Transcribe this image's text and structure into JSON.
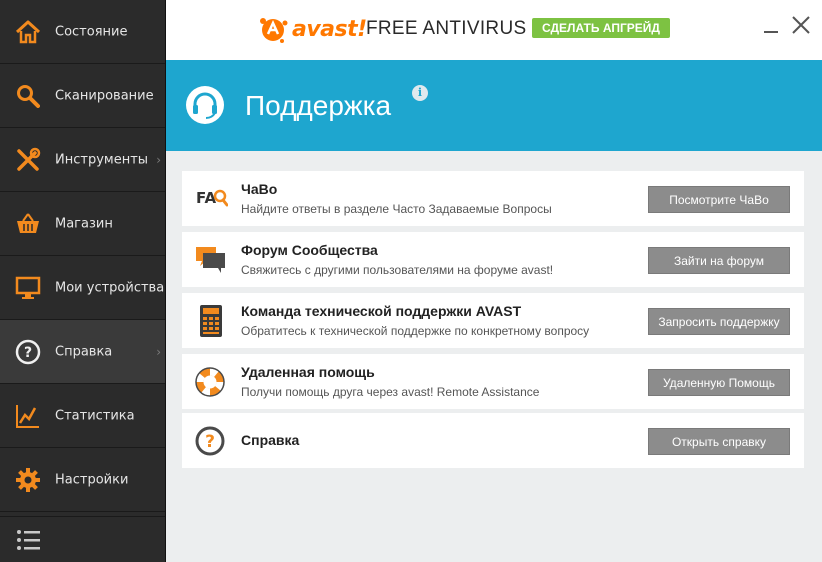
{
  "app": {
    "brand": "avast!",
    "product": "FREE ANTIVIRUS",
    "upgrade_label": "СДЕЛАТЬ АПГРЕЙД",
    "brand_color": "#ff7800",
    "accent_color": "#1ea6cf",
    "upgrade_color": "#7dc242"
  },
  "sidebar": {
    "items": [
      {
        "label": "Состояние",
        "icon": "home-icon"
      },
      {
        "label": "Сканирование",
        "icon": "magnifier-icon"
      },
      {
        "label": "Инструменты",
        "icon": "tools-icon",
        "has_submenu": true
      },
      {
        "label": "Магазин",
        "icon": "basket-icon"
      },
      {
        "label": "Мои устройства",
        "icon": "monitor-icon"
      },
      {
        "label": "Справка",
        "icon": "help-icon",
        "has_submenu": true,
        "active": true
      },
      {
        "label": "Статистика",
        "icon": "chart-icon"
      },
      {
        "label": "Настройки",
        "icon": "gear-icon"
      }
    ],
    "bottom_icon": "list-icon"
  },
  "banner": {
    "title": "Поддержка",
    "icon": "headset-icon",
    "info": "i"
  },
  "cards": [
    {
      "title": "ЧаВо",
      "desc": "Найдите ответы в разделе Часто Задаваемые Вопросы",
      "button": "Посмотрите ЧаВо",
      "icon": "faq-icon",
      "icon_text": "FA"
    },
    {
      "title": "Форум Сообщества",
      "desc": "Свяжитесь с другими пользователями на форуме avast!",
      "button": "Зайти на форум",
      "icon": "forum-icon"
    },
    {
      "title": "Команда технической поддержки AVAST",
      "desc": "Обратитесь к технической поддержке по конкретному вопросу",
      "button": "Запросить поддержку",
      "icon": "calculator-icon"
    },
    {
      "title": "Удаленная помощь",
      "desc": "Получи помощь друга через avast! Remote Assistance",
      "button": "Удаленную Помощь",
      "icon": "lifebuoy-icon"
    },
    {
      "title": "Справка",
      "desc": "",
      "button": "Открыть справку",
      "icon": "help-question-icon"
    }
  ]
}
